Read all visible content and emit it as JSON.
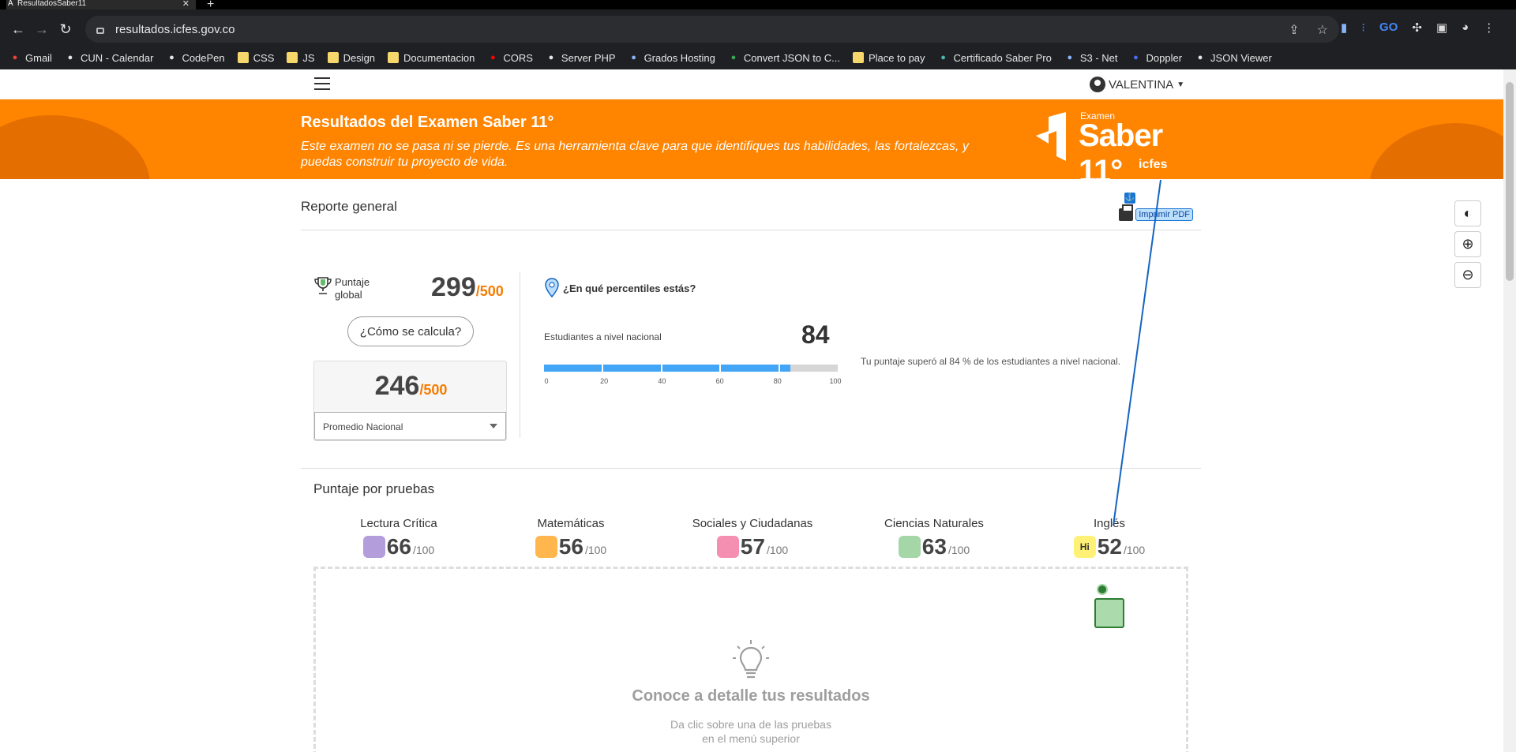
{
  "browser": {
    "tab_title": "ResultadosSaber11",
    "url": "resultados.icfes.gov.co",
    "bookmarks": [
      {
        "label": "Gmail",
        "icon": "gmail-icon",
        "color": "#ea4335"
      },
      {
        "label": "CUN - Calendar",
        "icon": "globe-icon",
        "color": "#e6e6e6"
      },
      {
        "label": "CodePen",
        "icon": "codepen-icon",
        "color": "#e6e6e6"
      },
      {
        "label": "CSS",
        "icon": "folder-icon",
        "color": "#f6d76b"
      },
      {
        "label": "JS",
        "icon": "folder-icon",
        "color": "#f6d76b"
      },
      {
        "label": "Design",
        "icon": "folder-icon",
        "color": "#f6d76b"
      },
      {
        "label": "Documentacion",
        "icon": "folder-icon",
        "color": "#f6d76b"
      },
      {
        "label": "CORS",
        "icon": "youtube-icon",
        "color": "#ff0000"
      },
      {
        "label": "Server PHP",
        "icon": "globe-icon",
        "color": "#e6e6e6"
      },
      {
        "label": "Grados Hosting",
        "icon": "p-icon",
        "color": "#8ab4f8"
      },
      {
        "label": "Convert JSON to C...",
        "icon": "convert-icon",
        "color": "#34a853"
      },
      {
        "label": "Place to pay",
        "icon": "folder-icon",
        "color": "#f6d76b"
      },
      {
        "label": "Certificado Saber Pro",
        "icon": "v-icon",
        "color": "#4db6ac"
      },
      {
        "label": "S3 - Net",
        "icon": "p-icon",
        "color": "#8ab4f8"
      },
      {
        "label": "Doppler",
        "icon": "doppler-icon",
        "color": "#4a6cf7"
      },
      {
        "label": "JSON Viewer",
        "icon": "jc-icon",
        "color": "#e6e6e6"
      }
    ]
  },
  "header": {
    "user_name": "VALENTINA"
  },
  "banner": {
    "title": "Resultados del Examen Saber 11°",
    "subtitle": "Este examen no se pasa ni se pierde. Es una herramienta clave para que identifiques tus habilidades, las fortalezcas, y puedas construir tu proyecto de vida.",
    "logo_small": "Examen",
    "logo_big": "Saber 11°",
    "logo_brand": "icfes"
  },
  "report": {
    "title": "Reporte general",
    "print_label": "Imprimir PDF",
    "global_label": "Puntaje global",
    "global_score": "299",
    "global_max": "/500",
    "calc_button": "¿Cómo se calcula?",
    "avg_score": "246",
    "avg_max": "/500",
    "avg_select": "Promedio Nacional"
  },
  "percentile": {
    "heading": "¿En qué percentiles estás?",
    "label": "Estudiantes a nivel nacional",
    "value": "84",
    "progress_fraction": 0.84,
    "ticks": [
      "0",
      "20",
      "40",
      "60",
      "80",
      "100"
    ],
    "text": "Tu puntaje superó al 84 % de los estudiantes a nivel nacional."
  },
  "tests": {
    "title": "Puntaje por pruebas",
    "denom": "/100",
    "items": [
      {
        "name": "Lectura Crítica",
        "score": "66",
        "icon": "book-icon",
        "color": "#b39ddb"
      },
      {
        "name": "Matemáticas",
        "score": "56",
        "icon": "calculator-icon",
        "color": "#ffb74d"
      },
      {
        "name": "Sociales y Ciudadanas",
        "score": "57",
        "icon": "globe-people-icon",
        "color": "#f48fb1"
      },
      {
        "name": "Ciencias Naturales",
        "score": "63",
        "icon": "plant-icon",
        "color": "#a5d6a7"
      },
      {
        "name": "Inglés",
        "score": "52",
        "icon": "speech-hi-icon",
        "color": "#fff176",
        "icon_text": "Hi"
      }
    ]
  },
  "detail": {
    "title": "Conoce a detalle tus resultados",
    "subtitle_line1": "Da clic sobre una de las pruebas",
    "subtitle_line2": "en el menú superior"
  }
}
